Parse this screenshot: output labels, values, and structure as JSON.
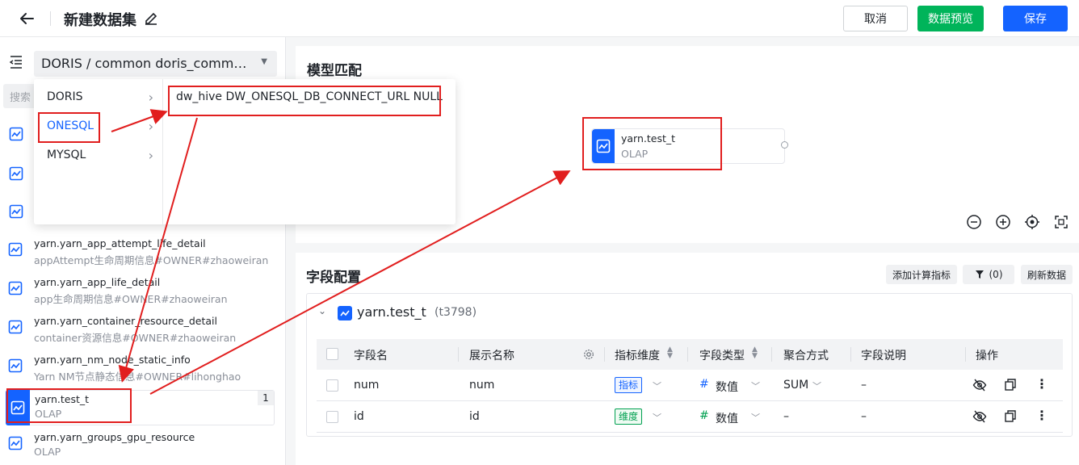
{
  "header": {
    "title": "新建数据集",
    "cancel_label": "取消",
    "preview_label": "数据预览",
    "save_label": "保存"
  },
  "sidebar": {
    "source_select": "DORIS / common doris_commo...",
    "search_placeholder": "搜索",
    "items": [
      {
        "name": "yarn.yarn_app_attempt_life_detail",
        "sub": "appAttempt生命周期信息#OWNER#zhaoweiran"
      },
      {
        "name": "yarn.yarn_app_life_detail",
        "sub": "app生命周期信息#OWNER#zhaoweiran"
      },
      {
        "name": "yarn.yarn_container_resource_detail",
        "sub": "container资源信息#OWNER#zhaoweiran"
      },
      {
        "name": "yarn.yarn_nm_node_static_info",
        "sub": "Yarn NM节点静态信息#OWNER#lihonghao"
      },
      {
        "name": "yarn.test_t",
        "sub": "OLAP",
        "count": "1"
      },
      {
        "name": "yarn.yarn_groups_gpu_resource",
        "sub": "OLAP"
      }
    ]
  },
  "cascader": {
    "level1": [
      "DORIS",
      "ONESQL",
      "MYSQL"
    ],
    "level2": "dw_hive DW_ONESQL_DB_CONNECT_URL NULL"
  },
  "model": {
    "title": "模型匹配",
    "node_name": "yarn.test_t",
    "node_sub": "OLAP"
  },
  "fields": {
    "title": "字段配置",
    "add_calc_label": "添加计算指标",
    "filter_label": "(0)",
    "refresh_label": "刷新数据",
    "table_name": "yarn.test_t",
    "table_code": "(t3798)",
    "headers": [
      "字段名",
      "展示名称",
      "指标维度",
      "字段类型",
      "聚合方式",
      "字段说明",
      "操作"
    ],
    "rows": [
      {
        "field": "num",
        "display": "num",
        "kind": "指标",
        "type": "数值",
        "agg": "SUM",
        "desc": "–"
      },
      {
        "field": "id",
        "display": "id",
        "kind": "维度",
        "type": "数值",
        "agg": "–",
        "desc": "–"
      }
    ]
  },
  "colors": {
    "primary": "#1463ff",
    "success": "#00b45a",
    "annotation": "#e11e1e"
  }
}
